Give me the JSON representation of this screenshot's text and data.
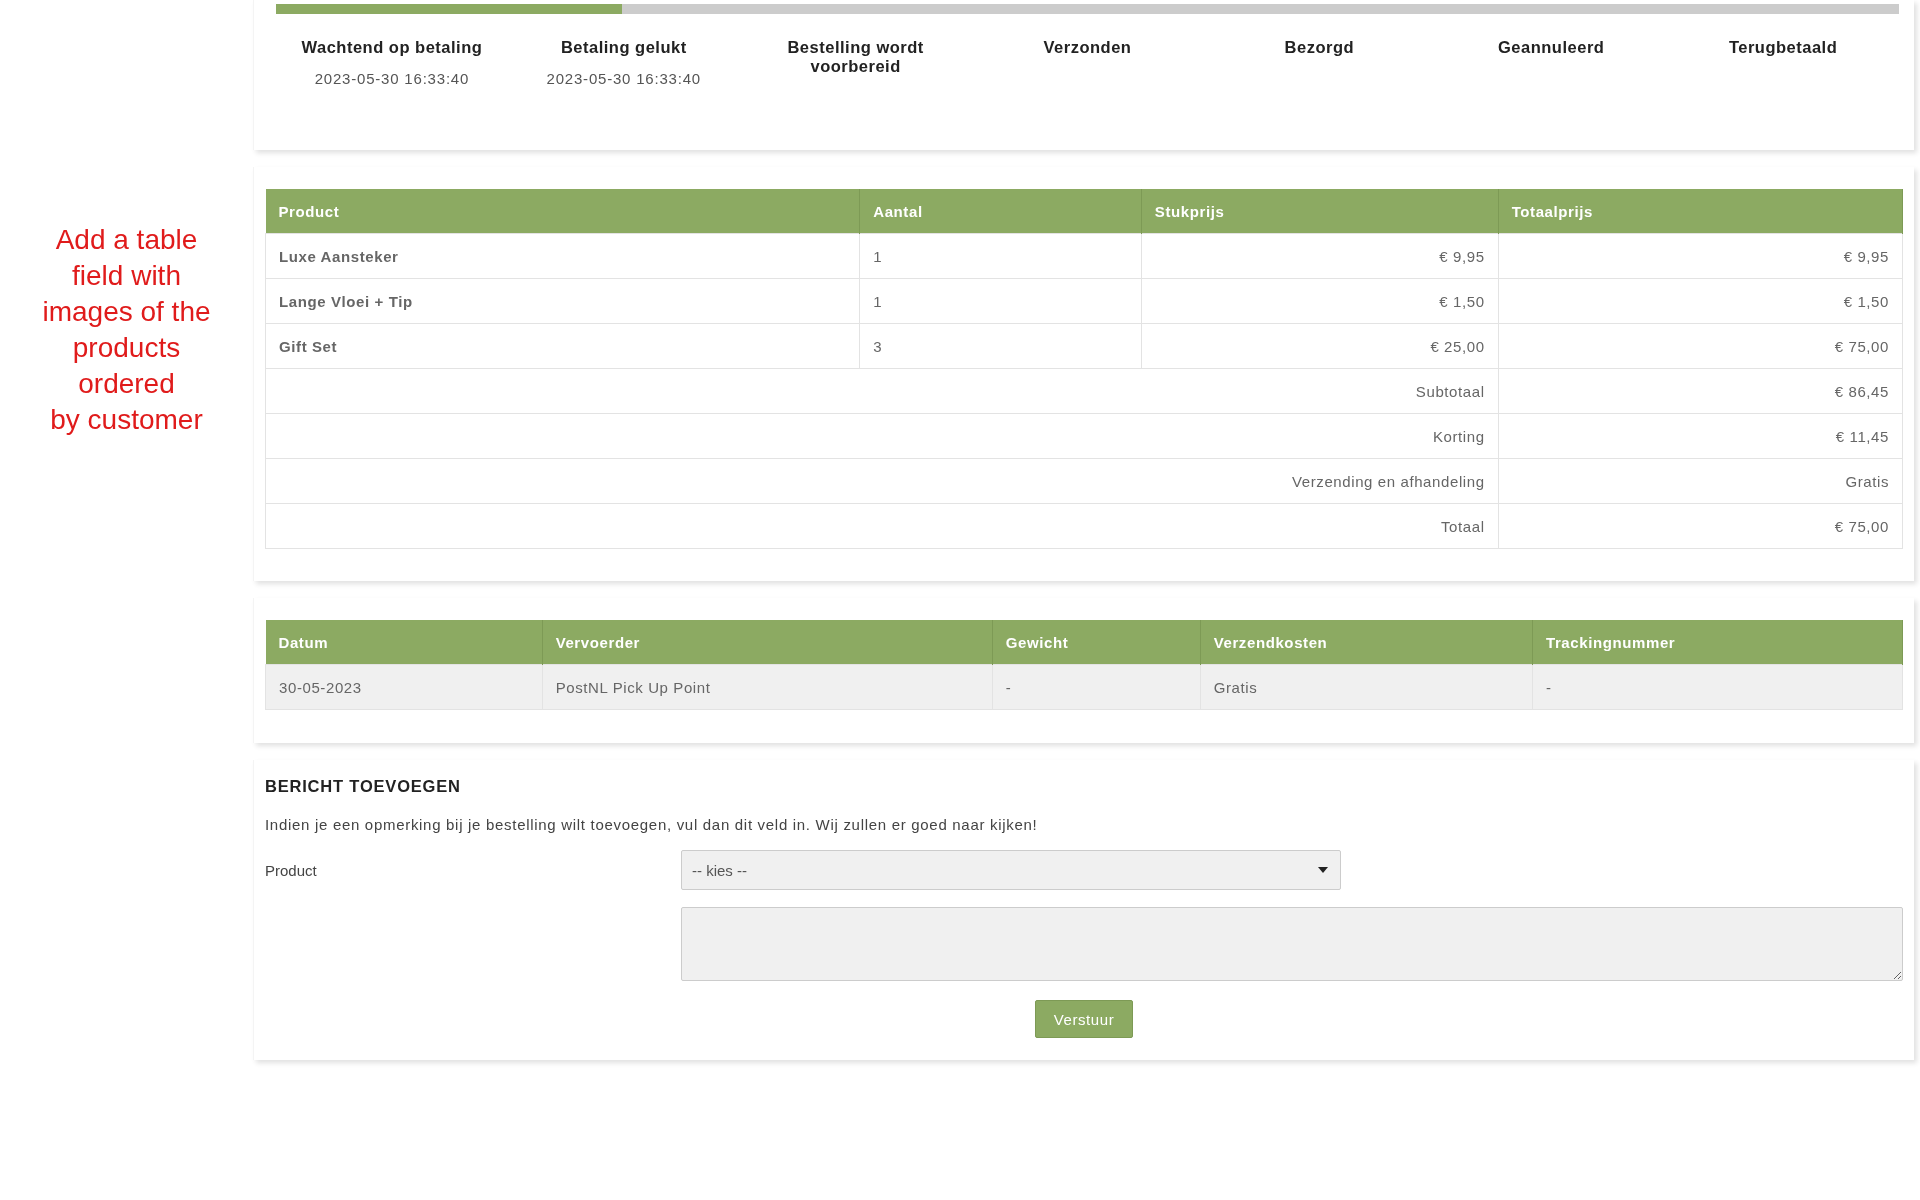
{
  "annotation": {
    "lines": [
      "Add a table",
      "field with",
      "images of the",
      "products",
      "ordered",
      "by customer"
    ]
  },
  "order_progress": {
    "level": 0.213,
    "steps": [
      {
        "label": "Wachtend op betaling",
        "time": "2023-05-30 16:33:40"
      },
      {
        "label": "Betaling gelukt",
        "time": "2023-05-30 16:33:40"
      },
      {
        "label": "Bestelling wordt voorbereid"
      },
      {
        "label": "Verzonden"
      },
      {
        "label": "Bezorgd"
      },
      {
        "label": "Geannuleerd"
      },
      {
        "label": "Terugbetaald"
      }
    ]
  },
  "products_table": {
    "columns": [
      "Product",
      "Aantal",
      "Stukprijs",
      "Totaalprijs"
    ],
    "rows": [
      [
        "Luxe Aansteker",
        "1",
        "€ 9,95",
        "€ 9,95"
      ],
      [
        "Lange Vloei + Tip",
        "1",
        "€ 1,50",
        "€ 1,50"
      ],
      [
        "Gift Set",
        "3",
        "€ 25,00",
        "€ 75,00"
      ]
    ],
    "totals": [
      {
        "label": "Subtotaal",
        "value": "€ 86,45"
      },
      {
        "label": "Korting",
        "value": "€ 11,45"
      },
      {
        "label": "Verzending en afhandeling",
        "value": "Gratis"
      },
      {
        "label": "Totaal",
        "value": "€ 75,00"
      }
    ]
  },
  "shipping_table": {
    "columns": [
      "Datum",
      "Vervoerder",
      "Gewicht",
      "Verzendkosten",
      "Trackingnummer"
    ],
    "rows": [
      [
        "30-05-2023",
        "PostNL Pick Up Point",
        "-",
        "Gratis",
        "-"
      ]
    ]
  },
  "message_form": {
    "title": "BERICHT TOEVOEGEN",
    "description": "Indien je een opmerking bij je bestelling wilt toevoegen, vul dan dit veld in. Wij zullen er goed naar kijken!",
    "product_label": "Product",
    "product_select": {
      "value": "-- kies --"
    },
    "submit": "Verstuur"
  }
}
